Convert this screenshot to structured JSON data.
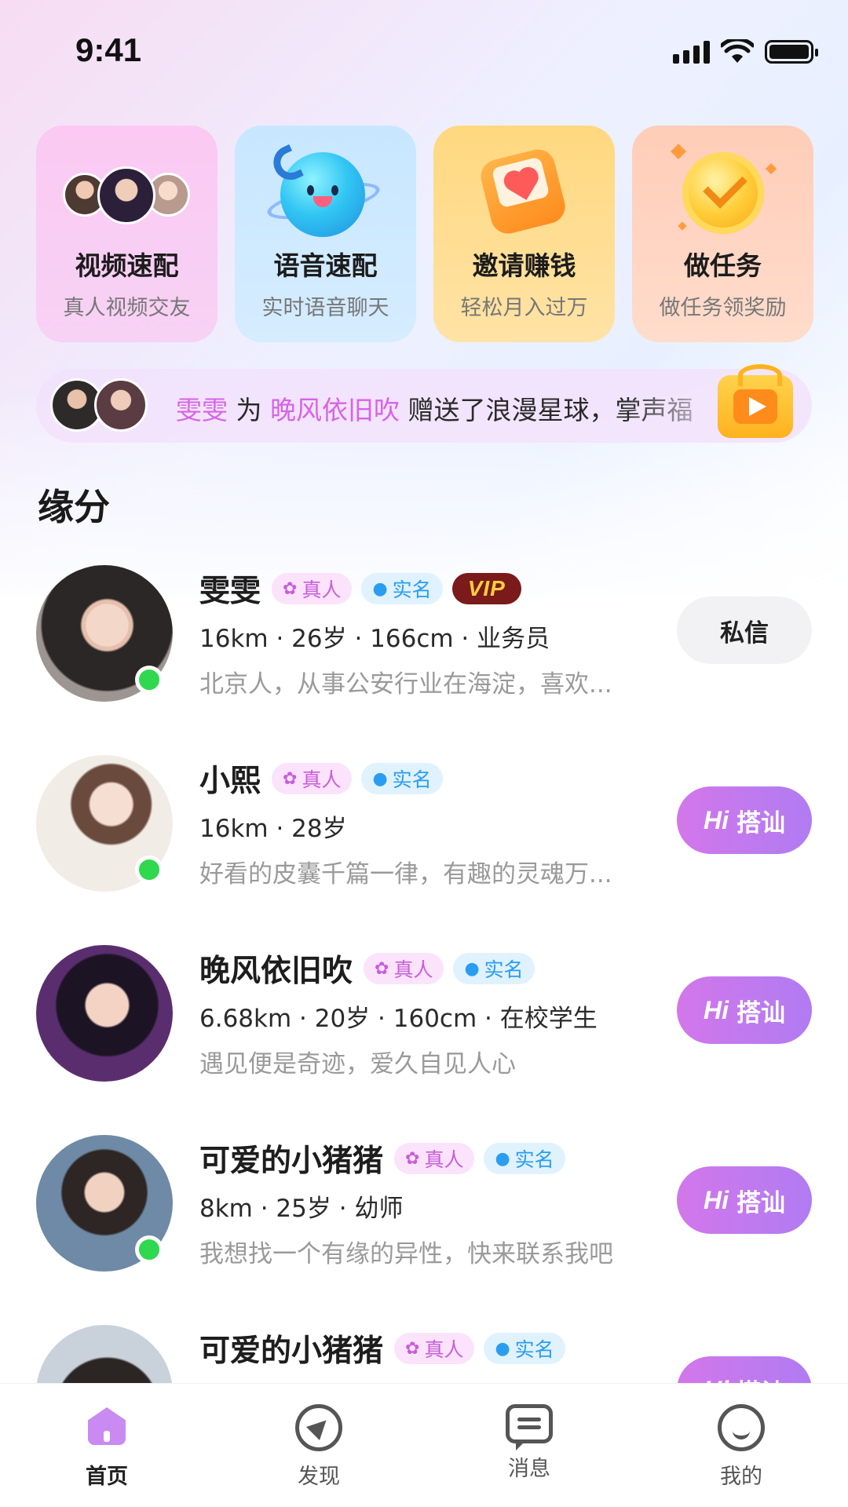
{
  "status_bar": {
    "time": "9:41"
  },
  "quick_actions": [
    {
      "title": "视频速配",
      "subtitle": "真人视频交友"
    },
    {
      "title": "语音速配",
      "subtitle": "实时语音聊天"
    },
    {
      "title": "邀请赚钱",
      "subtitle": "轻松月入过万"
    },
    {
      "title": "做任务",
      "subtitle": "做任务领奖励"
    }
  ],
  "ticker": {
    "sender": "雯雯",
    "connector": " 为 ",
    "receiver": "晚风依旧吹",
    "message": " 赠送了浪漫星球，掌声福"
  },
  "section": {
    "title": "缘分"
  },
  "users": [
    {
      "name": "雯雯",
      "real_tag": "真人",
      "verified_tag": "实名",
      "vip": "VIP",
      "meta": "16km · 26岁 · 166cm · 业务员",
      "bio": "北京人，从事公安行业在海淀，喜欢...",
      "action": "私信",
      "online": true
    },
    {
      "name": "小熙",
      "real_tag": "真人",
      "verified_tag": "实名",
      "meta": "16km · 28岁",
      "bio": "好看的皮囊千篇一律，有趣的灵魂万...",
      "action_hi": "Hi",
      "action": "搭讪",
      "online": true
    },
    {
      "name": "晚风依旧吹",
      "real_tag": "真人",
      "verified_tag": "实名",
      "meta": "6.68km · 20岁 · 160cm · 在校学生",
      "bio": "遇见便是奇迹，爱久自见人心",
      "action_hi": "Hi",
      "action": "搭讪",
      "online": false
    },
    {
      "name": "可爱的小猪猪",
      "real_tag": "真人",
      "verified_tag": "实名",
      "meta": "8km · 25岁 · 幼师",
      "bio": "我想找一个有缘的异性，快来联系我吧",
      "action_hi": "Hi",
      "action": "搭讪",
      "online": true
    },
    {
      "name": "可爱的小猪猪",
      "real_tag": "真人",
      "verified_tag": "实名",
      "meta": "",
      "bio": "",
      "action_hi": "Hi",
      "action": "搭讪",
      "online": false
    }
  ],
  "tab_bar": {
    "home": "首页",
    "discover": "发现",
    "messages": "消息",
    "mine": "我的"
  },
  "colors": {
    "accent": "#c98bf2",
    "online": "#2fd84f",
    "highlight_name": "#d763e8"
  }
}
